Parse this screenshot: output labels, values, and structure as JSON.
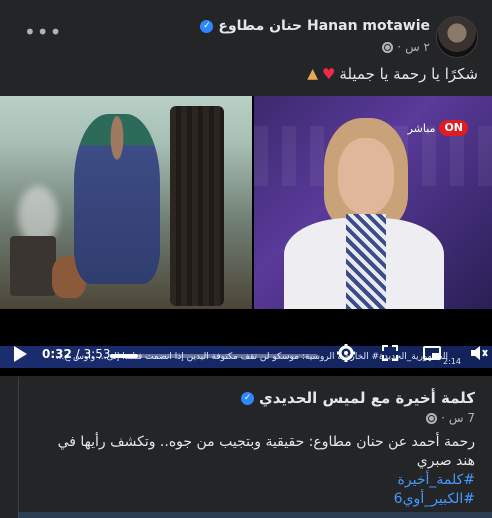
{
  "post": {
    "author": "Hanan motawie حنان مطاوع",
    "time": "٢ س",
    "caption": "شكرًا يا رحمة يا جميلة",
    "more_label": "•••"
  },
  "video": {
    "channel_badge": "ON",
    "channel_live": "مباشر",
    "ticker": "الجمهورية_الجديدة#    الخارجية الروسية: موسكو لن تقف مكتوفة اليدين إذا انضمت فنلندا إلى...    وأوس خ...",
    "current_time": "0:32",
    "separator": " / ",
    "duration": "3:53",
    "progress": 0.137,
    "mini_time": "2:14"
  },
  "shared": {
    "page_name": "كلمة أخيرة مع لميس الحديدي",
    "time": "7 س",
    "text": "رحمة أحمد عن حنان مطاوع: حقيقية وبتجيب من جوه.. وتكشف رأيها في هند صبري",
    "hashtags": [
      "#كلمة_أخيرة",
      "#الكبير_أوي6"
    ]
  },
  "colors": {
    "background": "#242526",
    "accent": "#2d88ff",
    "hashtag": "#4599ff",
    "on_red": "#e11b22"
  }
}
